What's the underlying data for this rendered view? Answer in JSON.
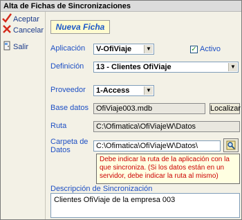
{
  "window": {
    "title": "Alta de Fichas de Sincronizaciones"
  },
  "toolbar": {
    "accept_label": "Aceptar",
    "cancel_label": "Cancelar",
    "exit_label": "Salir"
  },
  "banner": {
    "text": "Nueva Ficha"
  },
  "form": {
    "aplicacion_label": "Aplicación",
    "aplicacion_value": "V-OfiViaje",
    "activo_label": "Activo",
    "activo_checked": true,
    "definicion_label": "Definición",
    "definicion_value": "13 - Clientes OfiViaje",
    "proveedor_label": "Proveedor",
    "proveedor_value": "1-Access",
    "base_datos_label": "Base datos",
    "base_datos_value": "OfiViaje003.mdb",
    "localizar_label": "Localizar",
    "ruta_label": "Ruta",
    "ruta_value": "C:\\Ofimatica\\OfiViajeW\\Datos",
    "carpeta_label_line1": "Carpeta de",
    "carpeta_label_line2": "Datos",
    "carpeta_value": "C:\\Ofimatica\\OfiViajeW\\Datos\\",
    "tooltip_text": "Debe indicar la ruta de la aplicación con la que sincroniza. (Si los datos están en un servidor, debe indicar la ruta al mismo)",
    "descripcion_label": "Descripción de Sincronización",
    "descripcion_value": "Clientes OfiViaje de la empresa 003"
  },
  "colors": {
    "label_blue": "#1d4fc4",
    "banner_blue": "#1b58c8",
    "tooltip_red": "#cc0000",
    "tooltip_bg": "#ffffe1"
  }
}
